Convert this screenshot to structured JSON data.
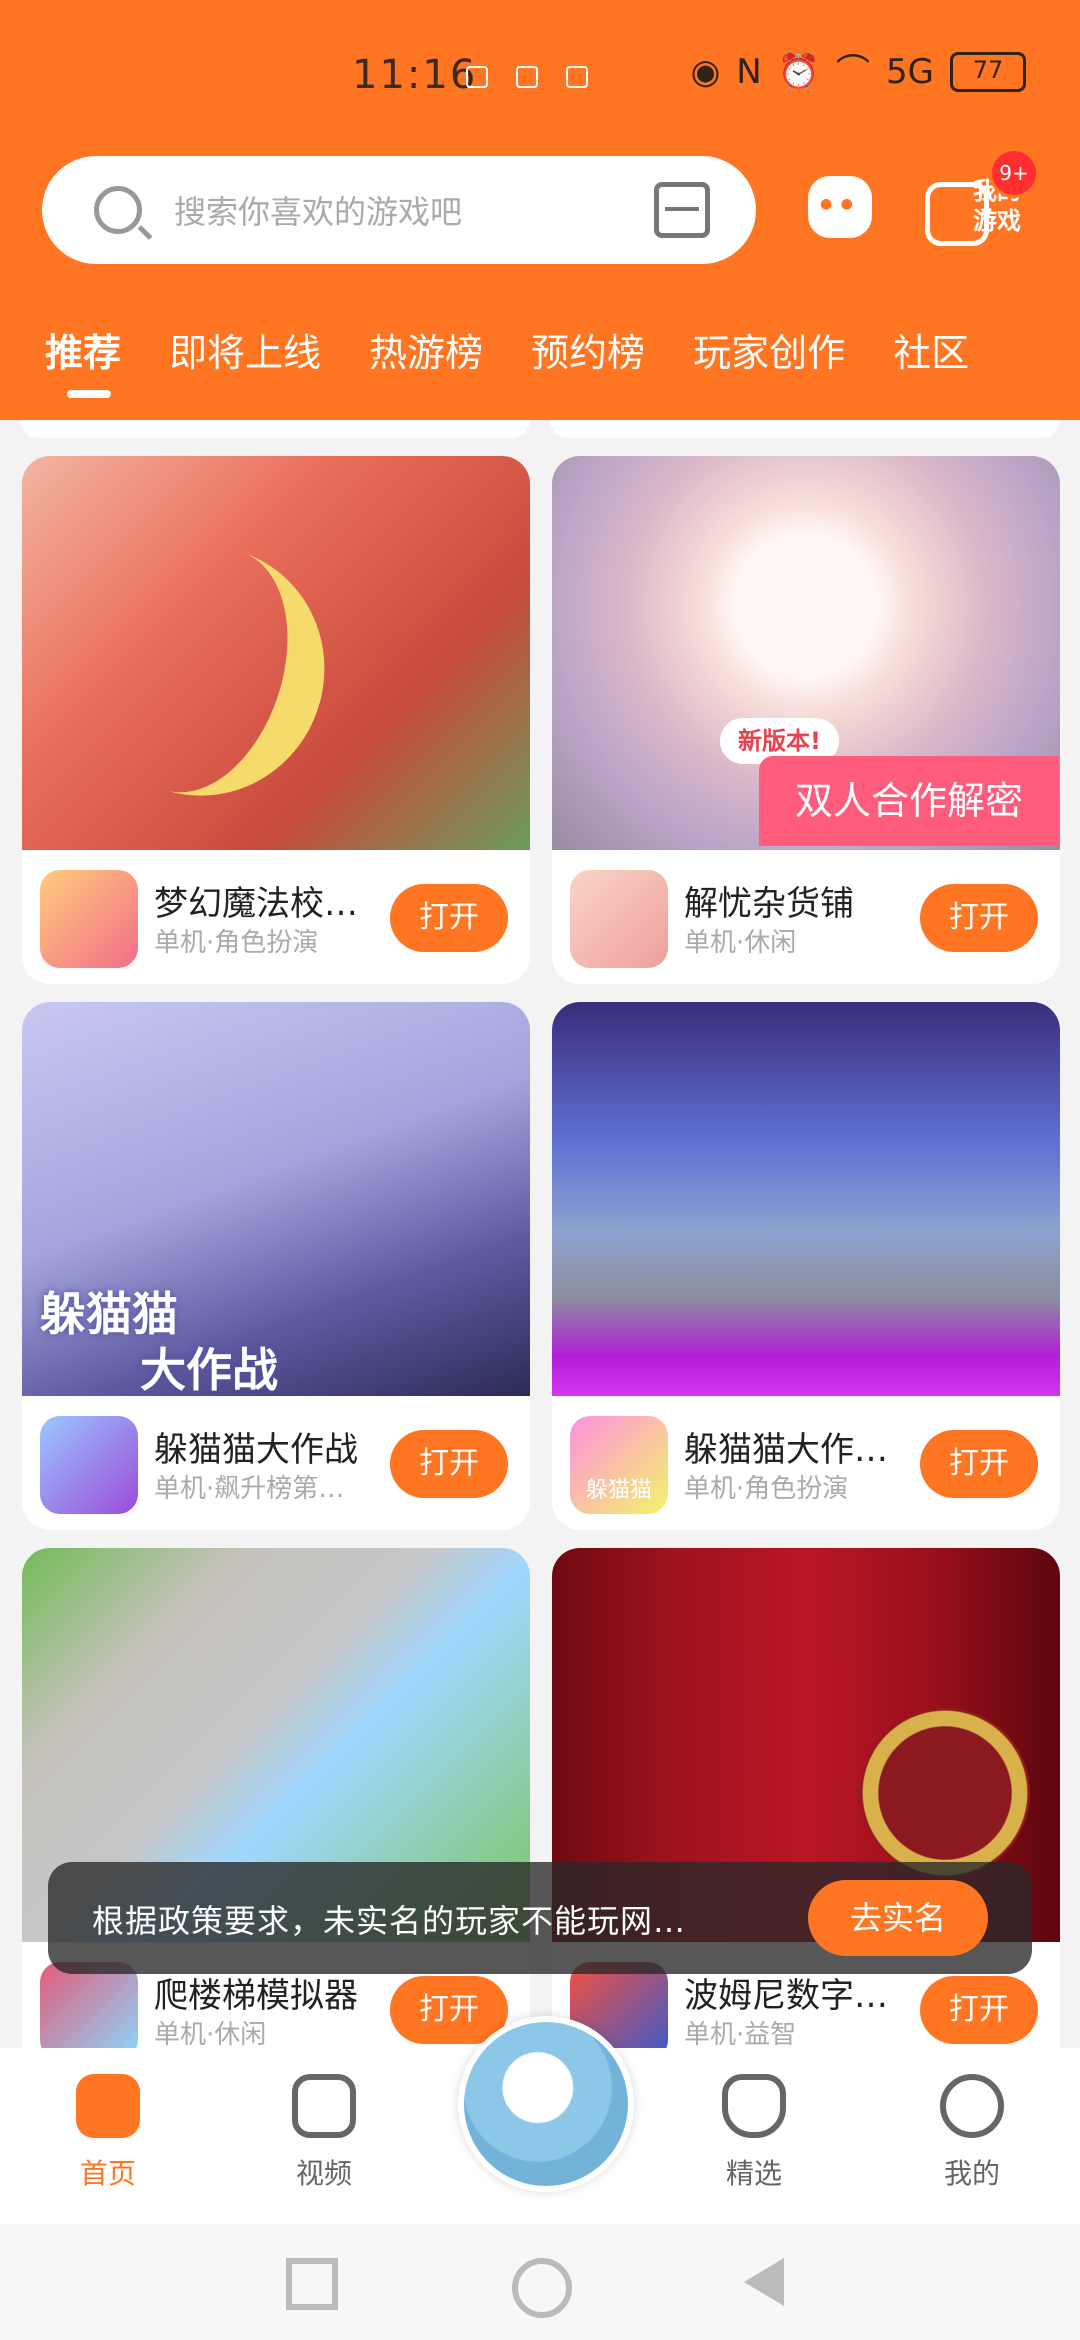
{
  "status_bar": {
    "time": "11:16",
    "battery": "77",
    "signal_label": "5G",
    "icons": [
      "eye-icon",
      "nfc-icon",
      "alarm-icon",
      "wifi-icon",
      "signal-icon"
    ]
  },
  "search": {
    "placeholder": "搜索你喜欢的游戏吧"
  },
  "header_actions": {
    "my_games_label": "我的\n游戏",
    "badge": "9+"
  },
  "tabs": [
    {
      "label": "推荐"
    },
    {
      "label": "即将上线"
    },
    {
      "label": "热游榜"
    },
    {
      "label": "预约榜"
    },
    {
      "label": "玩家创作"
    },
    {
      "label": "社区"
    }
  ],
  "cards": [
    {
      "title": "梦幻魔法校…",
      "subtitle": "单机·角色扮演",
      "button": "打开"
    },
    {
      "title": "解忧杂货铺",
      "subtitle": "单机·休闲",
      "button": "打开",
      "image_tag": "新版本!",
      "image_caption": "双人合作解密"
    },
    {
      "title": "躲猫猫大作战",
      "subtitle": "单机·飙升榜第…",
      "button": "打开",
      "image_caption_line1": "躲猫猫",
      "image_caption_line2": "大作战"
    },
    {
      "title": "躲猫猫大作…",
      "subtitle": "单机·角色扮演",
      "button": "打开",
      "thumb_text": "躲猫猫"
    },
    {
      "title": "爬楼梯模拟器",
      "subtitle": "单机·休闲",
      "button": "打开"
    },
    {
      "title": "波姆尼数字…",
      "subtitle": "单机·益智",
      "button": "打开"
    }
  ],
  "toast": {
    "message": "根据政策要求，未实名的玩家不能玩网…",
    "action": "去实名"
  },
  "bottom_nav": [
    {
      "label": "首页",
      "icon": "gamepad-icon"
    },
    {
      "label": "视频",
      "icon": "play-icon"
    },
    {
      "label": "精选",
      "icon": "heart-icon"
    },
    {
      "label": "我的",
      "icon": "profile-icon"
    }
  ],
  "colors": {
    "accent": "#ff7521",
    "toast_bg": "#2b2b2b",
    "text": "#222222"
  }
}
